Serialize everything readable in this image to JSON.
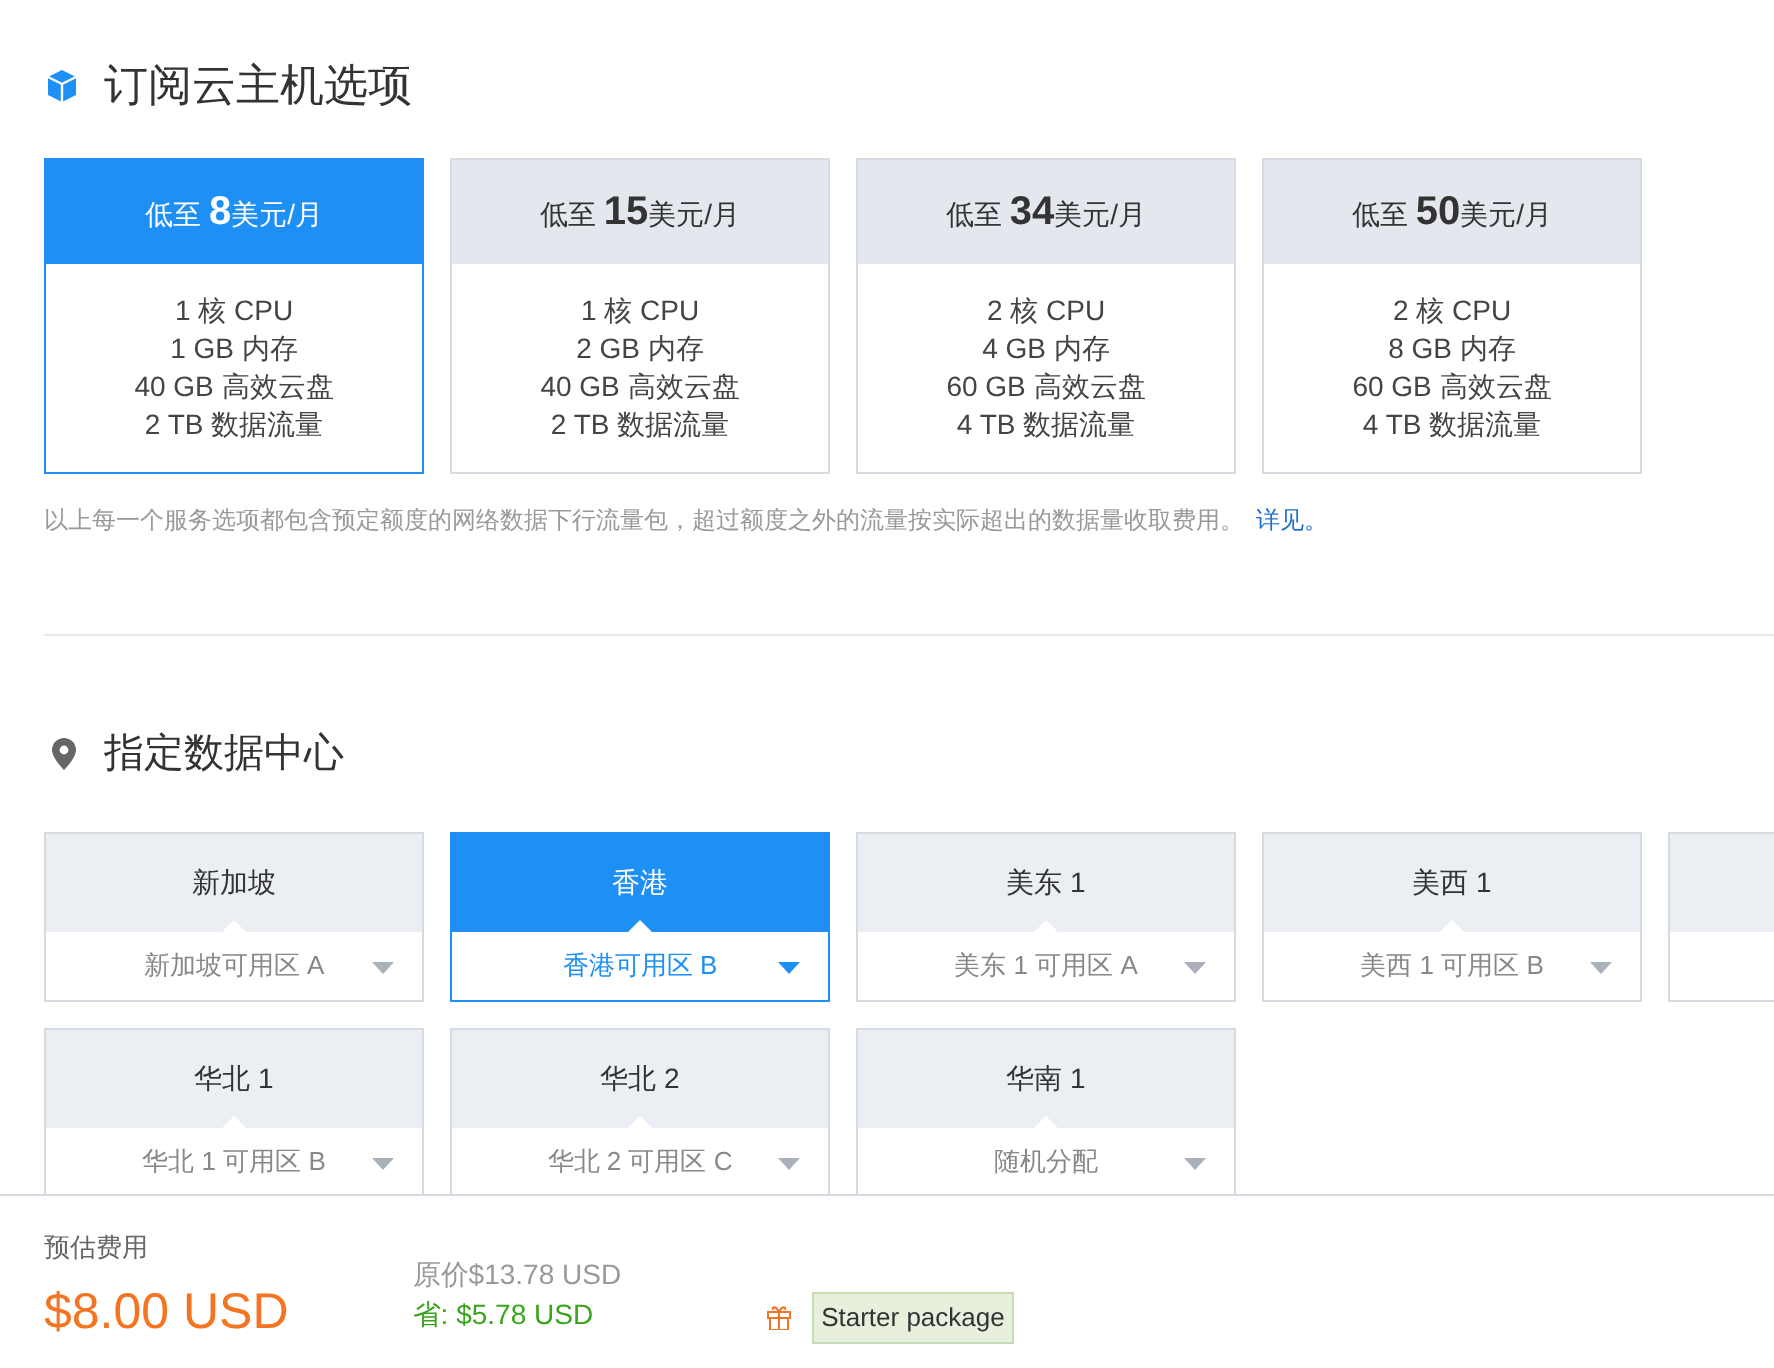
{
  "plans_section": {
    "title": "订阅云主机选项",
    "plans": [
      {
        "prefix": "低至",
        "price": "8",
        "unit": "美元/月",
        "selected": true,
        "specs": [
          "1 核 CPU",
          "1 GB 内存",
          "40 GB 高效云盘",
          "2 TB 数据流量"
        ]
      },
      {
        "prefix": "低至",
        "price": "15",
        "unit": "美元/月",
        "selected": false,
        "specs": [
          "1 核 CPU",
          "2 GB 内存",
          "40 GB 高效云盘",
          "2 TB 数据流量"
        ]
      },
      {
        "prefix": "低至",
        "price": "34",
        "unit": "美元/月",
        "selected": false,
        "specs": [
          "2 核 CPU",
          "4 GB 内存",
          "60 GB 高效云盘",
          "4 TB 数据流量"
        ]
      },
      {
        "prefix": "低至",
        "price": "50",
        "unit": "美元/月",
        "selected": false,
        "specs": [
          "2 核 CPU",
          "8 GB 内存",
          "60 GB 高效云盘",
          "4 TB 数据流量"
        ]
      }
    ],
    "note": "以上每一个服务选项都包含预定额度的网络数据下行流量包，超过额度之外的流量按实际超出的数据量收取费用。",
    "note_link": "详见。"
  },
  "regions_section": {
    "title": "指定数据中心",
    "regions": [
      {
        "name": "新加坡",
        "zone": "新加坡可用区 A",
        "selected": false
      },
      {
        "name": "香港",
        "zone": "香港可用区 B",
        "selected": true
      },
      {
        "name": "美东 1",
        "zone": "美东 1 可用区 A",
        "selected": false
      },
      {
        "name": "美西 1",
        "zone": "美西 1 可用区 B",
        "selected": false
      },
      {
        "name": "华北 1",
        "zone": "华北 1 可用区 B",
        "selected": false
      },
      {
        "name": "华北 2",
        "zone": "华北 2 可用区 C",
        "selected": false
      },
      {
        "name": "华南 1",
        "zone": "随机分配",
        "selected": false
      }
    ]
  },
  "footer": {
    "label": "预估费用",
    "total": "$8.00 USD",
    "original": "原价$13.78 USD",
    "saving": "省: $5.78 USD",
    "badge": "Starter package"
  }
}
